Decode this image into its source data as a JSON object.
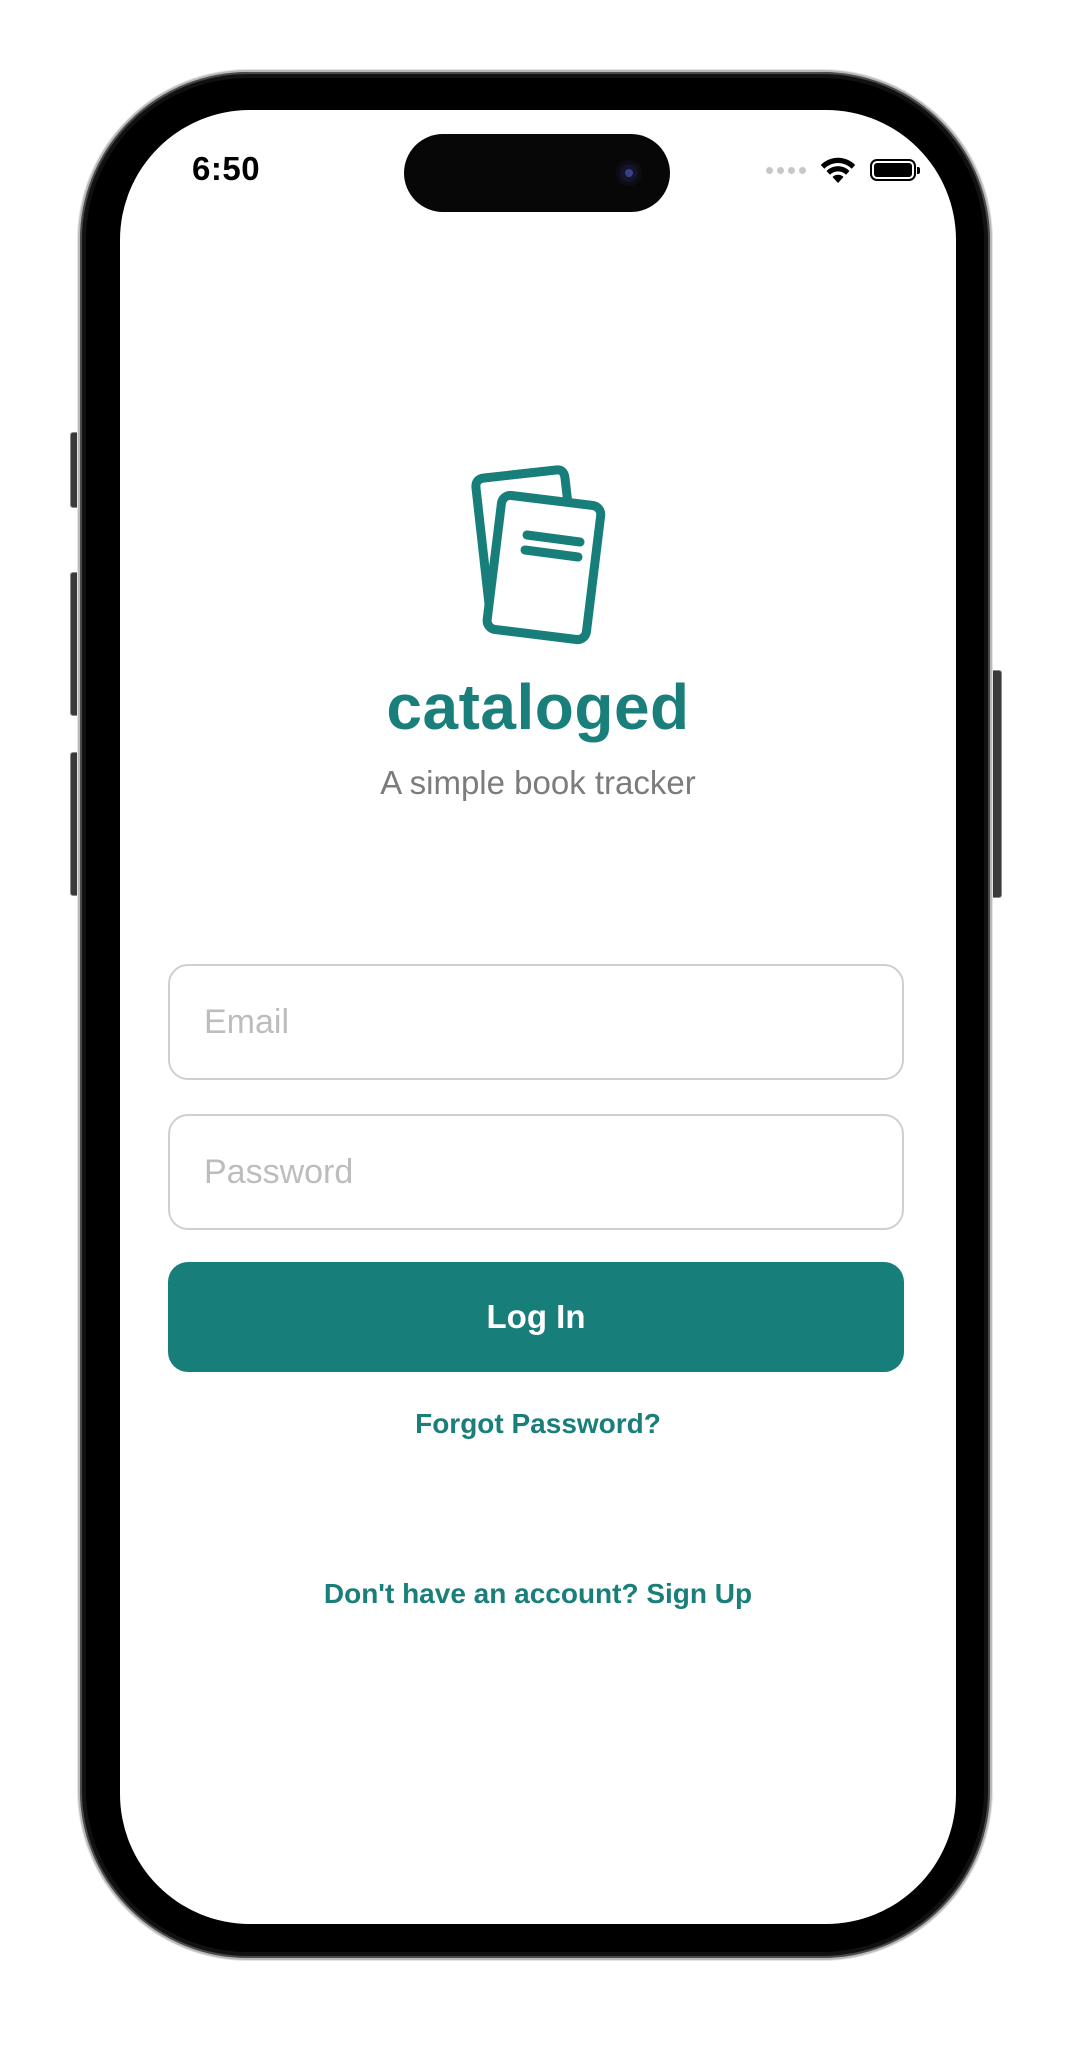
{
  "status_bar": {
    "time": "6:50"
  },
  "app": {
    "name": "cataloged",
    "tagline": "A simple book tracker",
    "logo_icon": "books-icon"
  },
  "login_form": {
    "email_placeholder": "Email",
    "email_value": "",
    "password_placeholder": "Password",
    "password_value": "",
    "submit_label": "Log In"
  },
  "links": {
    "forgot_password": "Forgot Password?",
    "sign_up": "Don't have an account? Sign Up"
  },
  "colors": {
    "brand": "#177e7a",
    "tagline_text": "#7c7c7c",
    "field_border": "#cfcfcf",
    "placeholder": "#bdbdbd"
  }
}
